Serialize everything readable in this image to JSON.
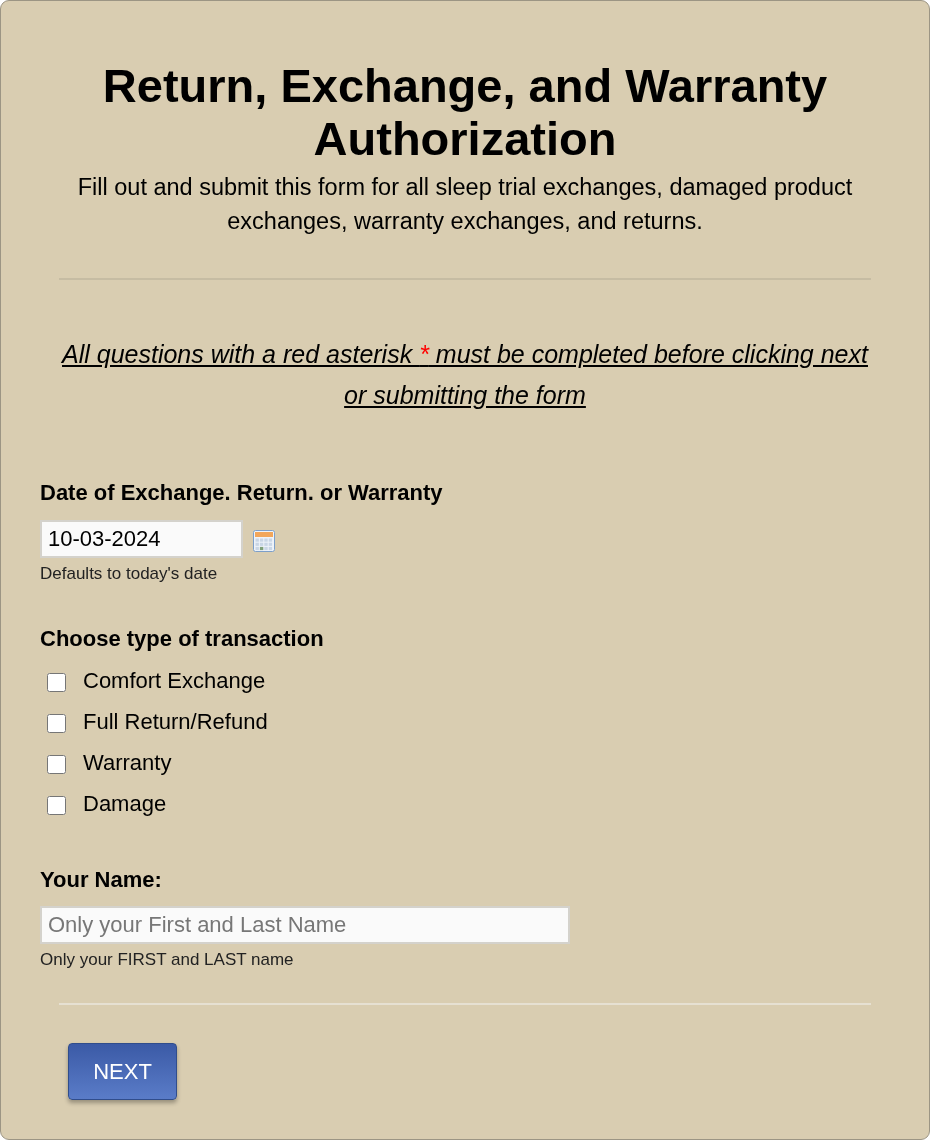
{
  "form": {
    "title": "Return, Exchange, and Warranty Authorization",
    "subtitle": "Fill out and submit this form for all sleep trial exchanges, damaged product exchanges, warranty exchanges, and returns.",
    "notice": {
      "before": "All questions with a red asterisk ",
      "marker": "*",
      "after": " must be completed before clicking next or submitting the form"
    }
  },
  "fields": [
    {
      "kind": "date",
      "label": "Date of Exchange. Return. or Warranty",
      "value": "10-03-2024",
      "help": "Defaults to today's date"
    },
    {
      "kind": "checkboxes",
      "label": "Choose type of transaction",
      "options": [
        {
          "label": "Comfort Exchange",
          "checked": false
        },
        {
          "label": "Full Return/Refund",
          "checked": false
        },
        {
          "label": "Warranty",
          "checked": false
        },
        {
          "label": "Damage",
          "checked": false
        }
      ]
    },
    {
      "kind": "text",
      "label": "Your Name:",
      "placeholder": "Only your First and Last Name",
      "help": "Only your FIRST and LAST name"
    }
  ],
  "buttons": [
    {
      "label": "NEXT"
    }
  ]
}
